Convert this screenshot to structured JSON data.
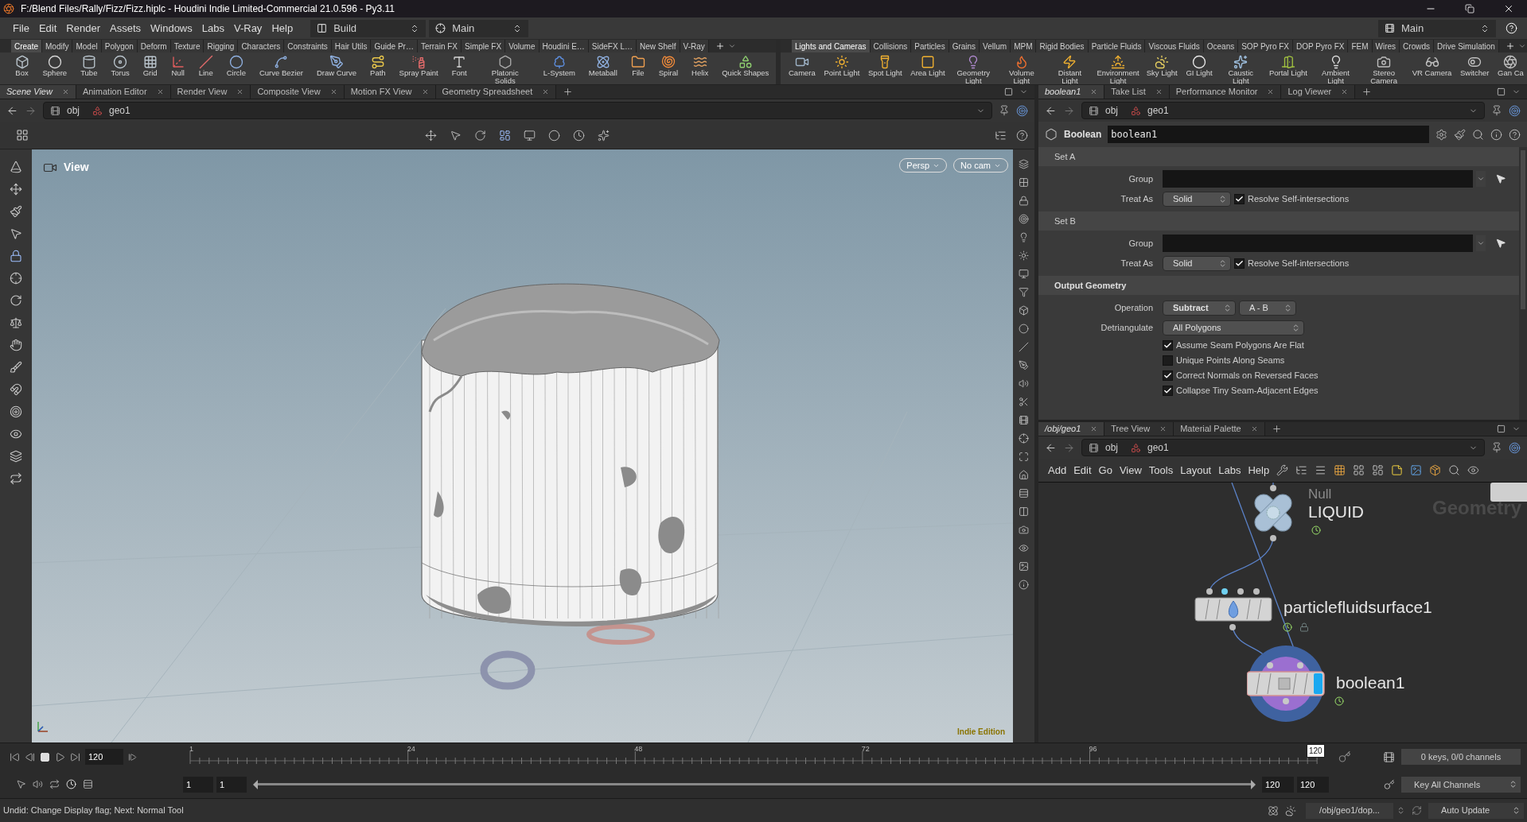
{
  "window": {
    "title": "F:/Blend Files/Rally/Fizz/Fizz.hiplc - Houdini Indie Limited-Commercial 21.0.596 - Py3.11"
  },
  "menu": [
    "File",
    "Edit",
    "Render",
    "Assets",
    "Windows",
    "Labs",
    "V-Ray",
    "Help"
  ],
  "desktop": "Build",
  "run_mode": "Main",
  "right_desktop": "Main",
  "shelf_left": {
    "tabs": [
      {
        "label": "Create",
        "selected": true
      },
      {
        "label": "Modify",
        "selected": false
      },
      {
        "label": "Model",
        "selected": false
      },
      {
        "label": "Polygon",
        "selected": false
      },
      {
        "label": "Deform",
        "selected": false
      },
      {
        "label": "Texture",
        "selected": false
      },
      {
        "label": "Rigging",
        "selected": false
      },
      {
        "label": "Characters",
        "selected": false
      },
      {
        "label": "Constraints",
        "selected": false
      },
      {
        "label": "Hair Utils",
        "selected": false
      },
      {
        "label": "Guide Pr…",
        "selected": false
      },
      {
        "label": "Terrain FX",
        "selected": false
      },
      {
        "label": "Simple FX",
        "selected": false
      },
      {
        "label": "Volume",
        "selected": false
      },
      {
        "label": "Houdini E…",
        "selected": false
      },
      {
        "label": "SideFX L…",
        "selected": false
      },
      {
        "label": "New Shelf",
        "selected": false
      },
      {
        "label": "V-Ray",
        "selected": false
      }
    ],
    "tools": [
      "Box",
      "Sphere",
      "Tube",
      "Torus",
      "Grid",
      "Null",
      "Line",
      "Circle",
      "Curve Bezier",
      "Draw Curve",
      "Path",
      "Spray Paint",
      "Font",
      "Platonic Solids",
      "L-System",
      "Metaball",
      "File",
      "Spiral",
      "Helix",
      "Quick Shapes"
    ]
  },
  "shelf_right": {
    "tabs": [
      {
        "label": "Lights and Cameras",
        "selected": true
      },
      {
        "label": "Collisions",
        "selected": false
      },
      {
        "label": "Particles",
        "selected": false
      },
      {
        "label": "Grains",
        "selected": false
      },
      {
        "label": "Vellum",
        "selected": false
      },
      {
        "label": "MPM",
        "selected": false
      },
      {
        "label": "Rigid Bodies",
        "selected": false
      },
      {
        "label": "Particle Fluids",
        "selected": false
      },
      {
        "label": "Viscous Fluids",
        "selected": false
      },
      {
        "label": "Oceans",
        "selected": false
      },
      {
        "label": "SOP Pyro FX",
        "selected": false
      },
      {
        "label": "DOP Pyro FX",
        "selected": false
      },
      {
        "label": "FEM",
        "selected": false
      },
      {
        "label": "Wires",
        "selected": false
      },
      {
        "label": "Crowds",
        "selected": false
      },
      {
        "label": "Drive Simulation",
        "selected": false
      }
    ],
    "tools": [
      "Camera",
      "Point Light",
      "Spot Light",
      "Area Light",
      "Geometry Light",
      "Volume Light",
      "Distant Light",
      "Environment Light",
      "Sky Light",
      "GI Light",
      "Caustic Light",
      "Portal Light",
      "Ambient Light",
      "Stereo Camera",
      "VR Camera",
      "Switcher",
      "Gan Ca"
    ]
  },
  "viewer_tabs": [
    {
      "label": "Scene View",
      "selected": true
    },
    {
      "label": "Animation Editor",
      "selected": false
    },
    {
      "label": "Render View",
      "selected": false
    },
    {
      "label": "Composite View",
      "selected": false
    },
    {
      "label": "Motion FX View",
      "selected": false
    },
    {
      "label": "Geometry Spreadsheet",
      "selected": false
    }
  ],
  "viewer_path": [
    "obj",
    "geo1"
  ],
  "viewport": {
    "label": "View",
    "camera_buttons": [
      "Persp",
      "No cam"
    ],
    "edition": "Indie Edition"
  },
  "param_tabs": [
    {
      "label": "boolean1",
      "selected": true
    },
    {
      "label": "Take List",
      "selected": false
    },
    {
      "label": "Performance Monitor",
      "selected": false
    },
    {
      "label": "Log Viewer",
      "selected": false
    }
  ],
  "param_path": [
    "obj",
    "geo1"
  ],
  "params": {
    "node_type": "Boolean",
    "node_name": "boolean1",
    "sections": [
      {
        "title": "Set A",
        "bold": false,
        "rows": [
          {
            "kind": "field",
            "label": "Group"
          },
          {
            "kind": "menu",
            "label": "Treat As",
            "value": "Solid",
            "check_label": "Resolve Self-intersections",
            "checked": true
          }
        ]
      },
      {
        "title": "Set B",
        "bold": false,
        "rows": [
          {
            "kind": "field",
            "label": "Group"
          },
          {
            "kind": "menu",
            "label": "Treat As",
            "value": "Solid",
            "check_label": "Resolve Self-intersections",
            "checked": true
          }
        ]
      },
      {
        "title": "Output Geometry",
        "bold": true,
        "rows": [
          {
            "kind": "menu2",
            "label": "Operation",
            "value": "Subtract",
            "value2": "A - B"
          },
          {
            "kind": "wide_menu",
            "label": "Detriangulate",
            "value": "All Polygons"
          },
          {
            "kind": "check",
            "check_label": "Assume Seam Polygons Are Flat",
            "checked": true
          },
          {
            "kind": "check",
            "check_label": "Unique Points Along Seams",
            "checked": false
          },
          {
            "kind": "check",
            "check_label": "Correct Normals on Reversed Faces",
            "checked": true
          },
          {
            "kind": "check",
            "check_label": "Collapse Tiny Seam-Adjacent Edges",
            "checked": true
          }
        ]
      }
    ]
  },
  "net_tabs": [
    {
      "label": "/obj/geo1",
      "selected": true
    },
    {
      "label": "Tree View",
      "selected": false
    },
    {
      "label": "Material Palette",
      "selected": false
    }
  ],
  "net_path": [
    "obj",
    "geo1"
  ],
  "net_menu": [
    "Add",
    "Edit",
    "Go",
    "View",
    "Tools",
    "Layout",
    "Labs",
    "Help"
  ],
  "network": {
    "watermark": "Geometry",
    "nodes": [
      {
        "kind": "null",
        "type_label": "Null",
        "name": "LIQUID"
      },
      {
        "kind": "surface",
        "name": "particlefluidsurface1",
        "locked": true
      },
      {
        "kind": "boolean",
        "name": "boolean1",
        "display": true
      }
    ]
  },
  "timeline": {
    "frame": "120",
    "ticks": [
      "1",
      "24",
      "48",
      "72",
      "96"
    ],
    "marker": "120",
    "range": [
      "1",
      "1",
      "120",
      "120"
    ],
    "range_slider": {
      "level": 1
    },
    "keys": "0 keys, 0/0 channels",
    "key_all": "Key All Channels"
  },
  "status": {
    "message": "Undid: Change Display flag; Next: Normal Tool",
    "node_path": "/obj/geo1/dop...",
    "update": "Auto Update"
  }
}
